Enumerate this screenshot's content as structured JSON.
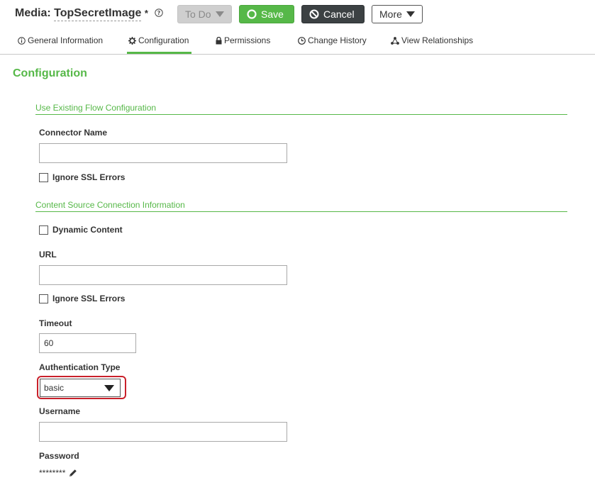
{
  "header": {
    "title_prefix": "Media:",
    "title_name": "TopSecretImage",
    "title_modified": "*",
    "todo_label": "To Do",
    "save_label": "Save",
    "cancel_label": "Cancel",
    "more_label": "More"
  },
  "tabs": [
    {
      "label": "General Information",
      "icon": "info-icon"
    },
    {
      "label": "Configuration",
      "icon": "gear-icon",
      "active": true
    },
    {
      "label": "Permissions",
      "icon": "lock-icon"
    },
    {
      "label": "Change History",
      "icon": "clock-icon"
    },
    {
      "label": "View Relationships",
      "icon": "network-icon"
    }
  ],
  "page_title": "Configuration",
  "sections": {
    "flow": {
      "heading": "Use Existing Flow Configuration",
      "connector_label": "Connector Name",
      "connector_value": "",
      "ignore_ssl_label": "Ignore SSL Errors"
    },
    "content_source": {
      "heading": "Content Source Connection Information",
      "dynamic_content_label": "Dynamic Content",
      "url_label": "URL",
      "url_value": "",
      "ignore_ssl_label": "Ignore SSL Errors",
      "timeout_label": "Timeout",
      "timeout_value": "60",
      "auth_type_label": "Authentication Type",
      "auth_type_value": "basic",
      "username_label": "Username",
      "username_value": "",
      "password_label": "Password",
      "password_value": "********"
    }
  },
  "colors": {
    "accent_green": "#56b848",
    "cancel_dark": "#3c4143",
    "highlight_red": "#c9202a"
  }
}
